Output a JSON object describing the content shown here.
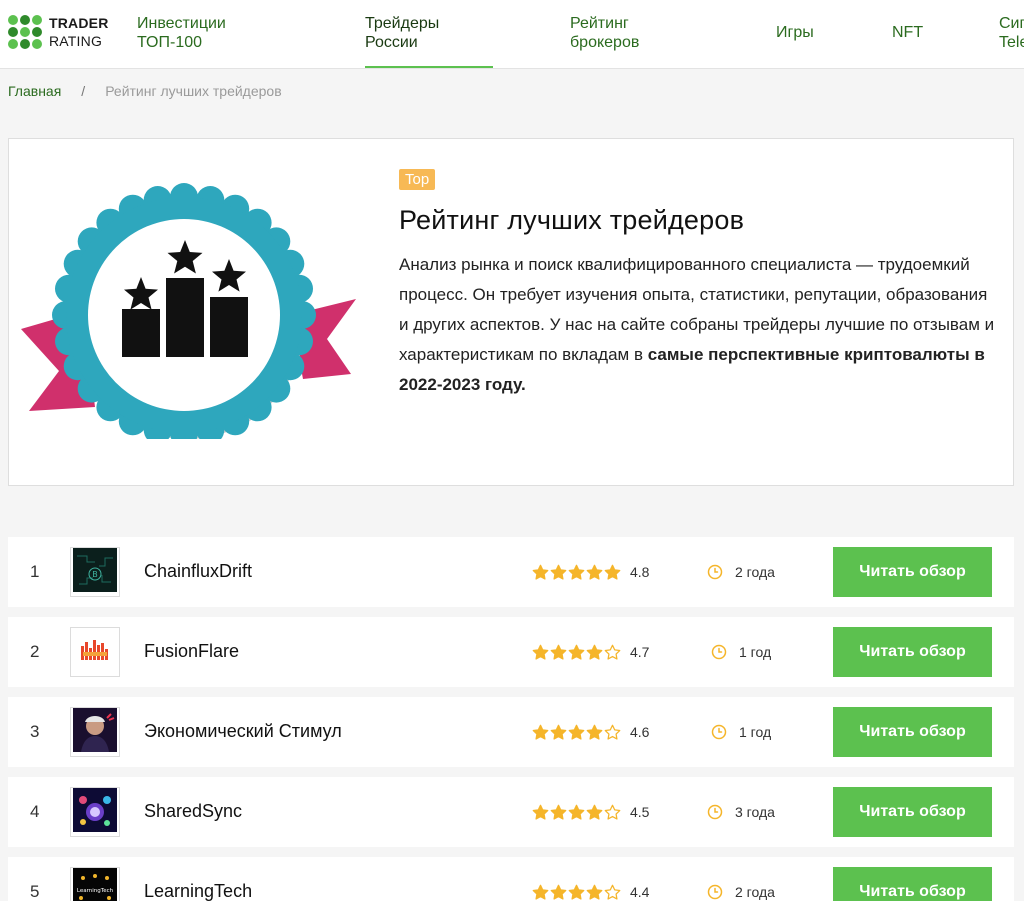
{
  "logo": {
    "line1": "TRADER",
    "line2": "RATING"
  },
  "nav": [
    {
      "l1": "Инвестиции",
      "l2": "ТОП-100"
    },
    {
      "l1": "Трейдеры",
      "l2": "России"
    },
    {
      "l1": "Рейтинг",
      "l2": "брокеров"
    },
    {
      "l1": "Игры"
    },
    {
      "l1": "NFT"
    },
    {
      "l1": "Сиг",
      "l2": "Tele"
    }
  ],
  "breadcrumb": {
    "home": "Главная",
    "separator": "/",
    "current": "Рейтинг лучших трейдеров"
  },
  "hero": {
    "tag": "Top",
    "title": "Рейтинг лучших трейдеров",
    "description": "Анализ рынка и поиск квалифицированного специалиста — трудоемкий процесс. Он требует изучения опыта, статистики, репутации, образования и других аспектов. У нас на сайте собраны трейдеры лучшие по отзывам и характеристикам по вкладам в",
    "description_bold": "самые перспективные криптовалюты в 2022-2023 году."
  },
  "colors": {
    "accent": "#5cc14f",
    "star": "#f5b52a",
    "tag": "#f7b955",
    "badge_teal": "#2ea7bd",
    "ribbon": "#d0306c"
  },
  "traders": [
    {
      "num": "1",
      "name": "ChainfluxDrift",
      "stars": 5,
      "rating": "4.8",
      "duration": "2 года",
      "button": "Читать обзор",
      "avatar_icon": "chainflux-logo-icon"
    },
    {
      "num": "2",
      "name": "FusionFlare",
      "stars": 4,
      "rating": "4.7",
      "duration": "1 год",
      "button": "Читать обзор",
      "avatar_icon": "fusionflare-logo-icon"
    },
    {
      "num": "3",
      "name": "Экономический Стимул",
      "stars": 4,
      "rating": "4.6",
      "duration": "1 год",
      "button": "Читать обзор",
      "avatar_icon": "portrait-logo-icon"
    },
    {
      "num": "4",
      "name": "SharedSync",
      "stars": 4,
      "rating": "4.5",
      "duration": "3 года",
      "button": "Читать обзор",
      "avatar_icon": "sharedsync-logo-icon"
    },
    {
      "num": "5",
      "name": "LearningTech",
      "stars": 4,
      "rating": "4.4",
      "duration": "2 года",
      "button": "Читать обзор",
      "avatar_icon": "learningtech-logo-icon"
    }
  ]
}
